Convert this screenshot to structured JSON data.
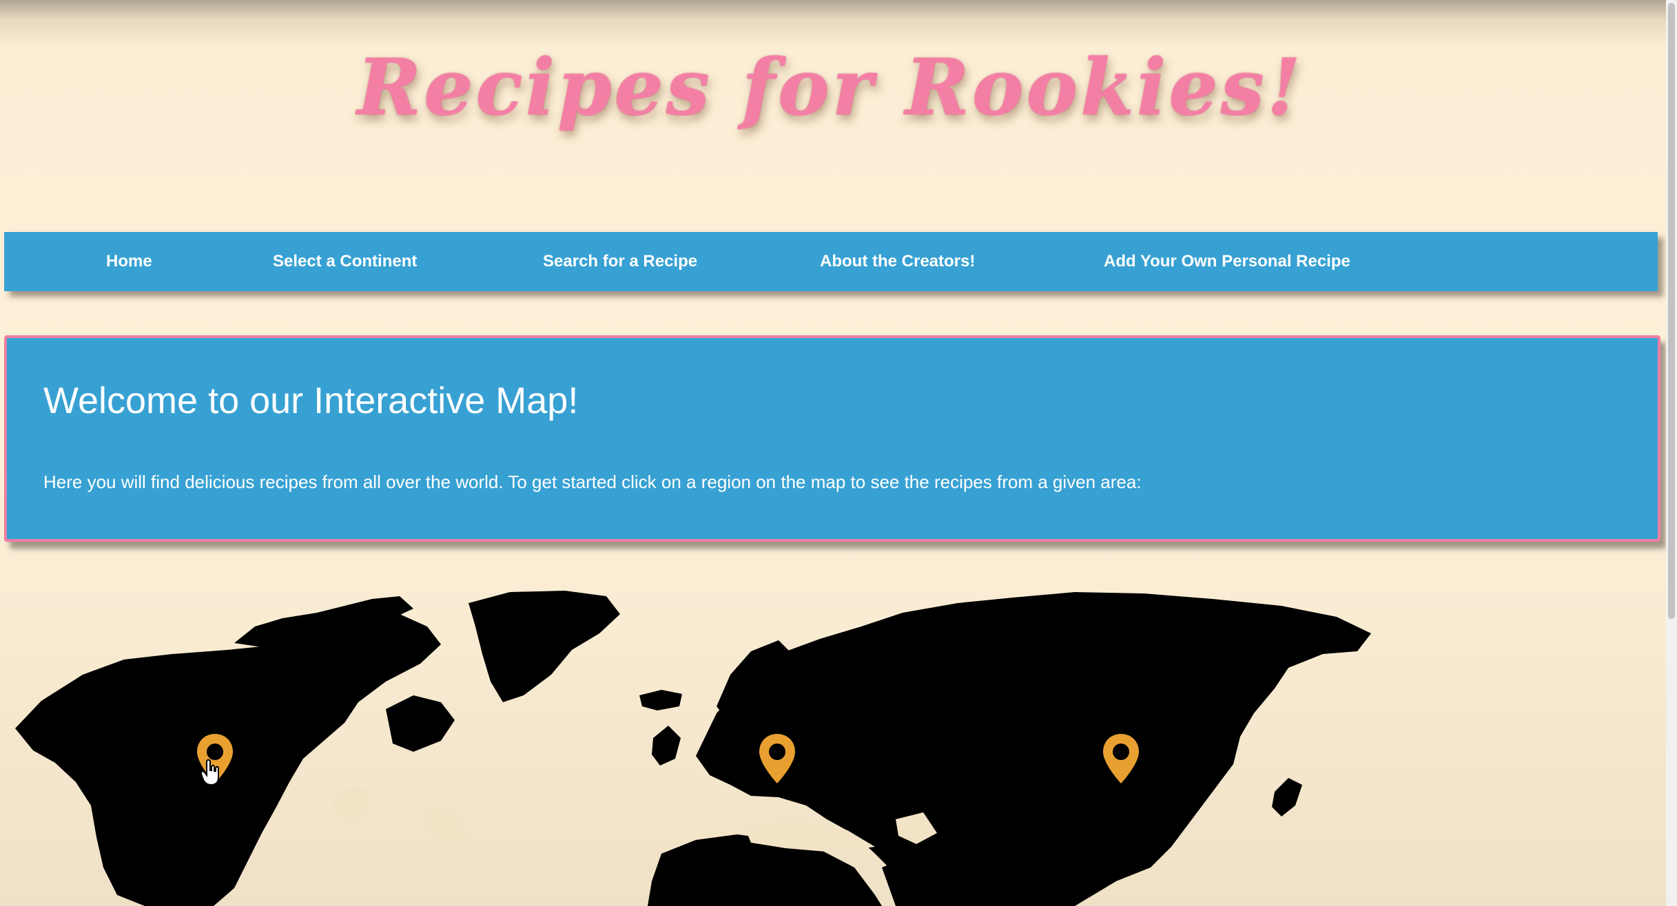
{
  "header": {
    "title": "Recipes for Rookies!"
  },
  "nav": {
    "items": [
      {
        "label": "Home"
      },
      {
        "label": "Select a Continent"
      },
      {
        "label": "Search for a Recipe"
      },
      {
        "label": "About the Creators!"
      },
      {
        "label": "Add Your Own Personal Recipe"
      }
    ]
  },
  "welcome": {
    "heading": "Welcome to our Interactive Map!",
    "text": "Here you will find delicious recipes from all over the world. To get started click on a region on the map to see the recipes from a given area:"
  },
  "map": {
    "land_color": "#000000",
    "pins": [
      {
        "icon": "map-pin-icon",
        "color": "#e8a031"
      },
      {
        "icon": "map-pin-icon",
        "color": "#e8a031"
      },
      {
        "icon": "map-pin-icon",
        "color": "#e8a031"
      }
    ]
  },
  "colors": {
    "background": "#fdf0d8",
    "nav_background": "#38a1d3",
    "panel_border": "#f07ea3",
    "title": "#f47fa5",
    "pin": "#e8a031"
  }
}
